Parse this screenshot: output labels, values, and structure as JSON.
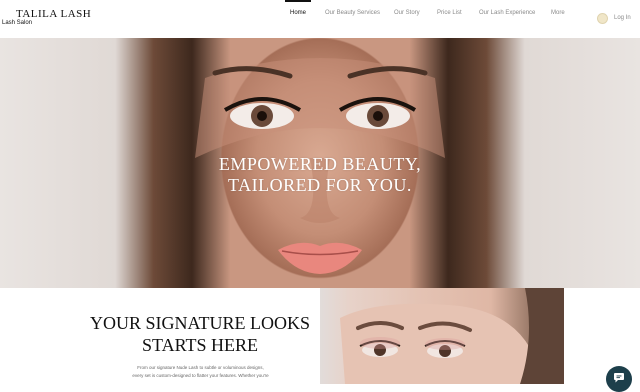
{
  "header": {
    "brand": "TALILA LASH",
    "tagline": "Lash Salon",
    "nav": [
      "Home",
      "Our Beauty Services",
      "Our Story",
      "Price List",
      "Our Lash Experience",
      "More"
    ],
    "active": "Home",
    "login": "Log In"
  },
  "hero": {
    "line1": "EMPOWERED BEAUTY,",
    "line2": "TAILORED FOR YOU."
  },
  "section": {
    "title_line1": "YOUR SIGNATURE LOOKS",
    "title_line2": "STARTS HERE",
    "intro_line1": "From our signature Nude Lash to subtle or voluminous designs,",
    "intro_line2": "every set is custom-designed to flatter your features. Whether you're",
    "intro_line3": ""
  },
  "icons": {
    "login": "user-avatar-icon",
    "chat": "chat-bubble-icon"
  },
  "colors": {
    "chat_button": "#1d3f4b",
    "active_nav": "#111111",
    "inactive_nav": "#8a8a8a"
  }
}
